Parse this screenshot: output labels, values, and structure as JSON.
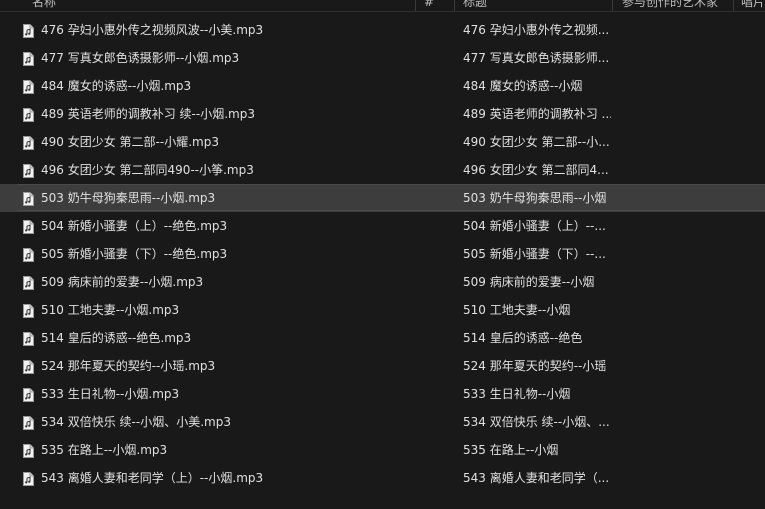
{
  "header": {
    "col_name": "名称",
    "col_hash": "#",
    "col_title": "标题",
    "col_artist": "参与创作的艺术家",
    "col_album": "唱片"
  },
  "files": [
    {
      "name": "476 孕妇小惠外传之视频风波--小美.mp3",
      "title": "476 孕妇小惠外传之视频..."
    },
    {
      "name": "477 写真女郎色诱摄影师--小烟.mp3",
      "title": "477 写真女郎色诱摄影师..."
    },
    {
      "name": "484 魔女的诱惑--小烟.mp3",
      "title": "484 魔女的诱惑--小烟"
    },
    {
      "name": "489 英语老师的调教补习 续--小烟.mp3",
      "title": "489 英语老师的调教补习 ..."
    },
    {
      "name": "490 女团少女 第二部--小耀.mp3",
      "title": "490 女团少女 第二部--小..."
    },
    {
      "name": "496 女团少女 第二部同490--小筝.mp3",
      "title": "496 女团少女 第二部同4..."
    },
    {
      "name": "503 奶牛母狗秦思雨--小烟.mp3",
      "title": "503 奶牛母狗秦思雨--小烟",
      "selected": true
    },
    {
      "name": "504 新婚小骚妻（上）--绝色.mp3",
      "title": "504 新婚小骚妻（上）--..."
    },
    {
      "name": "505 新婚小骚妻（下）--绝色.mp3",
      "title": "505 新婚小骚妻（下）--..."
    },
    {
      "name": "509  病床前的爱妻--小烟.mp3",
      "title": "509  病床前的爱妻--小烟"
    },
    {
      "name": "510 工地夫妻--小烟.mp3",
      "title": "510 工地夫妻--小烟"
    },
    {
      "name": "514 皇后的诱惑--绝色.mp3",
      "title": "514 皇后的诱惑--绝色"
    },
    {
      "name": "524 那年夏天的契约--小瑶.mp3",
      "title": "524 那年夏天的契约--小瑶"
    },
    {
      "name": "533 生日礼物--小烟.mp3",
      "title": "533 生日礼物--小烟"
    },
    {
      "name": "534 双倍快乐 续--小烟、小美.mp3",
      "title": "534 双倍快乐 续--小烟、..."
    },
    {
      "name": "535 在路上--小烟.mp3",
      "title": "535 在路上--小烟"
    },
    {
      "name": "543 离婚人妻和老同学（上）--小烟.mp3",
      "title": "543 离婚人妻和老同学（..."
    }
  ],
  "icons": {
    "file": "audio-file-icon"
  },
  "colors": {
    "background": "#191919",
    "selected": "#3d3d3d",
    "text": "#e0e0e0"
  }
}
